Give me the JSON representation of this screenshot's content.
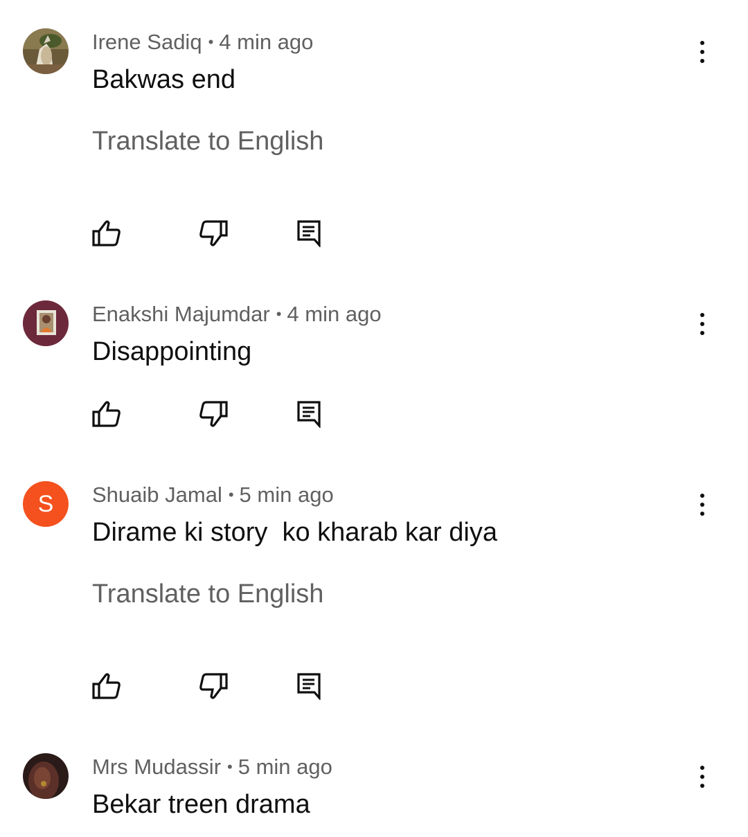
{
  "colors": {
    "primary_text": "#0f0f0f",
    "secondary_text": "#606060",
    "avatar_letter_bg": "#f4511e"
  },
  "comments": [
    {
      "author": "Irene Sadiq",
      "time": "4 min ago",
      "text": "Bakwas end",
      "translate": "Translate to English",
      "avatar": "wolf-photo"
    },
    {
      "author": "Enakshi Majumdar",
      "time": "4 min ago",
      "text": "Disappointing",
      "avatar": "portrait-frame-photo"
    },
    {
      "author": "Shuaib Jamal",
      "time": "5 min ago",
      "text": "Dirame ki story  ko kharab kar diya",
      "translate": "Translate to English",
      "avatar_letter": "S"
    },
    {
      "author": "Mrs Mudassir",
      "time": "5 min ago",
      "text": "Bekar treen drama",
      "avatar": "hand-photo"
    }
  ],
  "icons": {
    "like": "thumbs-up-icon",
    "dislike": "thumbs-down-icon",
    "reply": "comment-icon",
    "more": "more-vert-icon"
  }
}
